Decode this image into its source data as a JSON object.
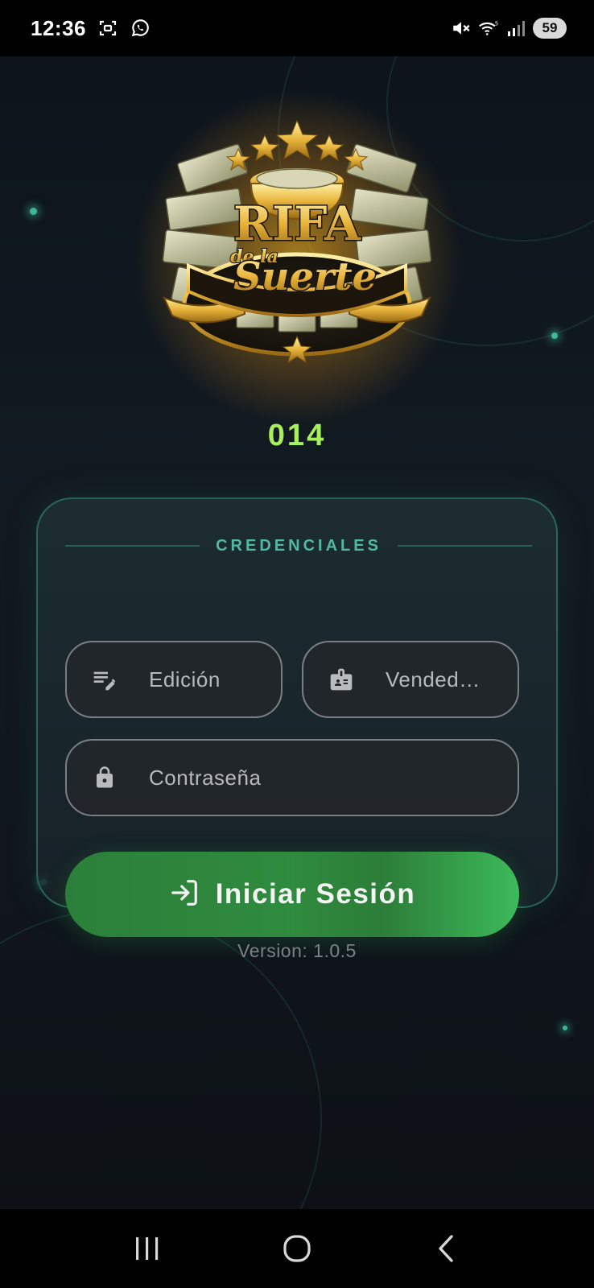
{
  "status_bar": {
    "time": "12:36",
    "battery": "59",
    "icons": [
      "screenshot-icon",
      "whatsapp-icon",
      "mute-icon",
      "wifi-icon",
      "signal-icon"
    ]
  },
  "app": {
    "logo": {
      "line1": "RIFA",
      "line2": "de la",
      "line3": "Suerte"
    },
    "code": "014",
    "credentials": {
      "title": "CREDENCIALES",
      "edition_placeholder": "Edición",
      "seller_placeholder": "Vended…",
      "password_placeholder": "Contraseña"
    },
    "login_button": {
      "label": "Iniciar Sesión",
      "icon": "login-icon"
    },
    "version": "Version: 1.0.5"
  },
  "nav_bar": {
    "buttons": [
      "recent-apps-icon",
      "home-icon",
      "back-icon"
    ]
  },
  "colors": {
    "accent_green": "#a6f05c",
    "teal": "#52b8a4",
    "button_green": "#2f8b3e",
    "gold": "#e8b43a"
  }
}
